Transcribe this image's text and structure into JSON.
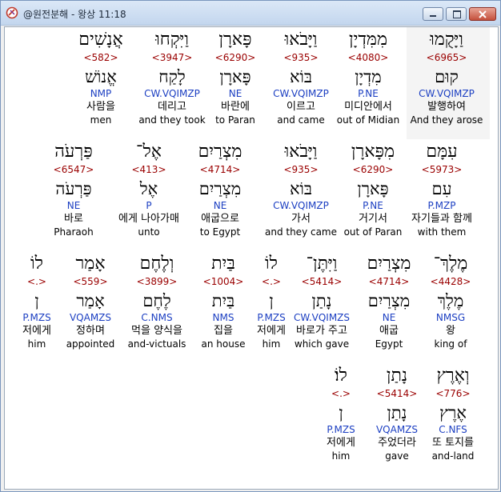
{
  "window": {
    "title": "@원전분해 - 왕상 11:18",
    "icon": "app-icon"
  },
  "rows": [
    [
      {
        "heb": "וַיָּקֻמוּ",
        "strong": "<6965>",
        "lex": "קוּם",
        "parse": "CW.VQIMZP",
        "kor": "발행하여",
        "eng": "And they arose",
        "highlight": true
      },
      {
        "heb": "מִמִּדְיָן",
        "strong": "<4080>",
        "lex": "מִדְיָן",
        "parse": "P.NE",
        "kor": "미디안에서",
        "eng": "out of Midian"
      },
      {
        "heb": "וַיָּבֹאוּ",
        "strong": "<935>",
        "lex": "בּוֹא",
        "parse": "CW.VQIMZP",
        "kor": "이르고",
        "eng": "and came"
      },
      {
        "heb": "פָּארָן",
        "strong": "<6290>",
        "lex": "פָּארָן",
        "parse": "NE",
        "kor": "바란에",
        "eng": "to Paran"
      },
      {
        "heb": "וַיִּקְחוּ",
        "strong": "<3947>",
        "lex": "לָקַח",
        "parse": "CW.VQIMZP",
        "kor": "데리고",
        "eng": "and they took"
      },
      {
        "heb": "אֲנָשִׁים",
        "strong": "<582>",
        "lex": "אֱנוֹשׁ",
        "parse": "NMP",
        "kor": "사람을",
        "eng": "men"
      }
    ],
    [
      {
        "heb": "עִמָּם",
        "strong": "<5973>",
        "lex": "עִם",
        "parse": "P.MZP",
        "kor": "자기들과 함께",
        "eng": "with them"
      },
      {
        "heb": "מִפָּארָן",
        "strong": "<6290>",
        "lex": "פָּארָן",
        "parse": "P.NE",
        "kor": "거기서",
        "eng": "out of Paran"
      },
      {
        "heb": "וַיָּבֹאוּ",
        "strong": "<935>",
        "lex": "בּוֹא",
        "parse": "CW.VQIMZP",
        "kor": "가서",
        "eng": "and they came"
      },
      {
        "heb": "מִצְרַיִם",
        "strong": "<4714>",
        "lex": "מִצְרַיִם",
        "parse": "NE",
        "kor": "애굽으로",
        "eng": "to Egypt"
      },
      {
        "heb": "אֶל־",
        "strong": "<413>",
        "lex": "אֶל",
        "parse": "P",
        "kor": "에게 나아가매",
        "eng": "unto"
      },
      {
        "heb": "פַּרְעֹה",
        "strong": "<6547>",
        "lex": "פַּרְעֹה",
        "parse": "NE",
        "kor": "바로",
        "eng": "Pharaoh"
      }
    ],
    [
      {
        "heb": "מֶלֶךְ־",
        "strong": "<4428>",
        "lex": "מֶלֶךְ",
        "parse": "NMSG",
        "kor": "왕",
        "eng": "king of"
      },
      {
        "heb": "מִצְרַיִם",
        "strong": "<4714>",
        "lex": "מִצְרַיִם",
        "parse": "NE",
        "kor": "애굽",
        "eng": "Egypt"
      },
      {
        "heb": "וַיִּתֶּן־",
        "strong": "<5414>",
        "lex": "נָתַן",
        "parse": "CW.VQIMZS",
        "kor": "바로가 주고",
        "eng": "which gave"
      },
      {
        "heb": "לוֹ",
        "strong": "<.>",
        "lex": "ן",
        "parse": "P.MZS",
        "kor": "저에게",
        "eng": "him"
      },
      {
        "heb": "בַּיִת",
        "strong": "<1004>",
        "lex": "בַּיִת",
        "parse": "NMS",
        "kor": "집을",
        "eng": "an house"
      },
      {
        "heb": "וְלֶחֶם",
        "strong": "<3899>",
        "lex": "לֶחֶם",
        "parse": "C.NMS",
        "kor": "먹을 양식을",
        "eng": "and-victuals"
      },
      {
        "heb": "אָמַר",
        "strong": "<559>",
        "lex": "אָמַר",
        "parse": "VQAMZS",
        "kor": "정하며",
        "eng": "appointed"
      },
      {
        "heb": "לוֹ",
        "strong": "<.>",
        "lex": "ן",
        "parse": "P.MZS",
        "kor": "저에게",
        "eng": "him"
      }
    ],
    [
      {
        "heb": "וְאֶרֶץ",
        "strong": "<776>",
        "lex": "אֶרֶץ",
        "parse": "C.NFS",
        "kor": "또 토지를",
        "eng": "and-land"
      },
      {
        "heb": "נָתַן",
        "strong": "<5414>",
        "lex": "נָתַן",
        "parse": "VQAMZS",
        "kor": "주었더라",
        "eng": "gave"
      },
      {
        "heb": "לוֹ׃",
        "strong": "<.>",
        "lex": "ן",
        "parse": "P.MZS",
        "kor": "저에게",
        "eng": "him"
      }
    ]
  ]
}
